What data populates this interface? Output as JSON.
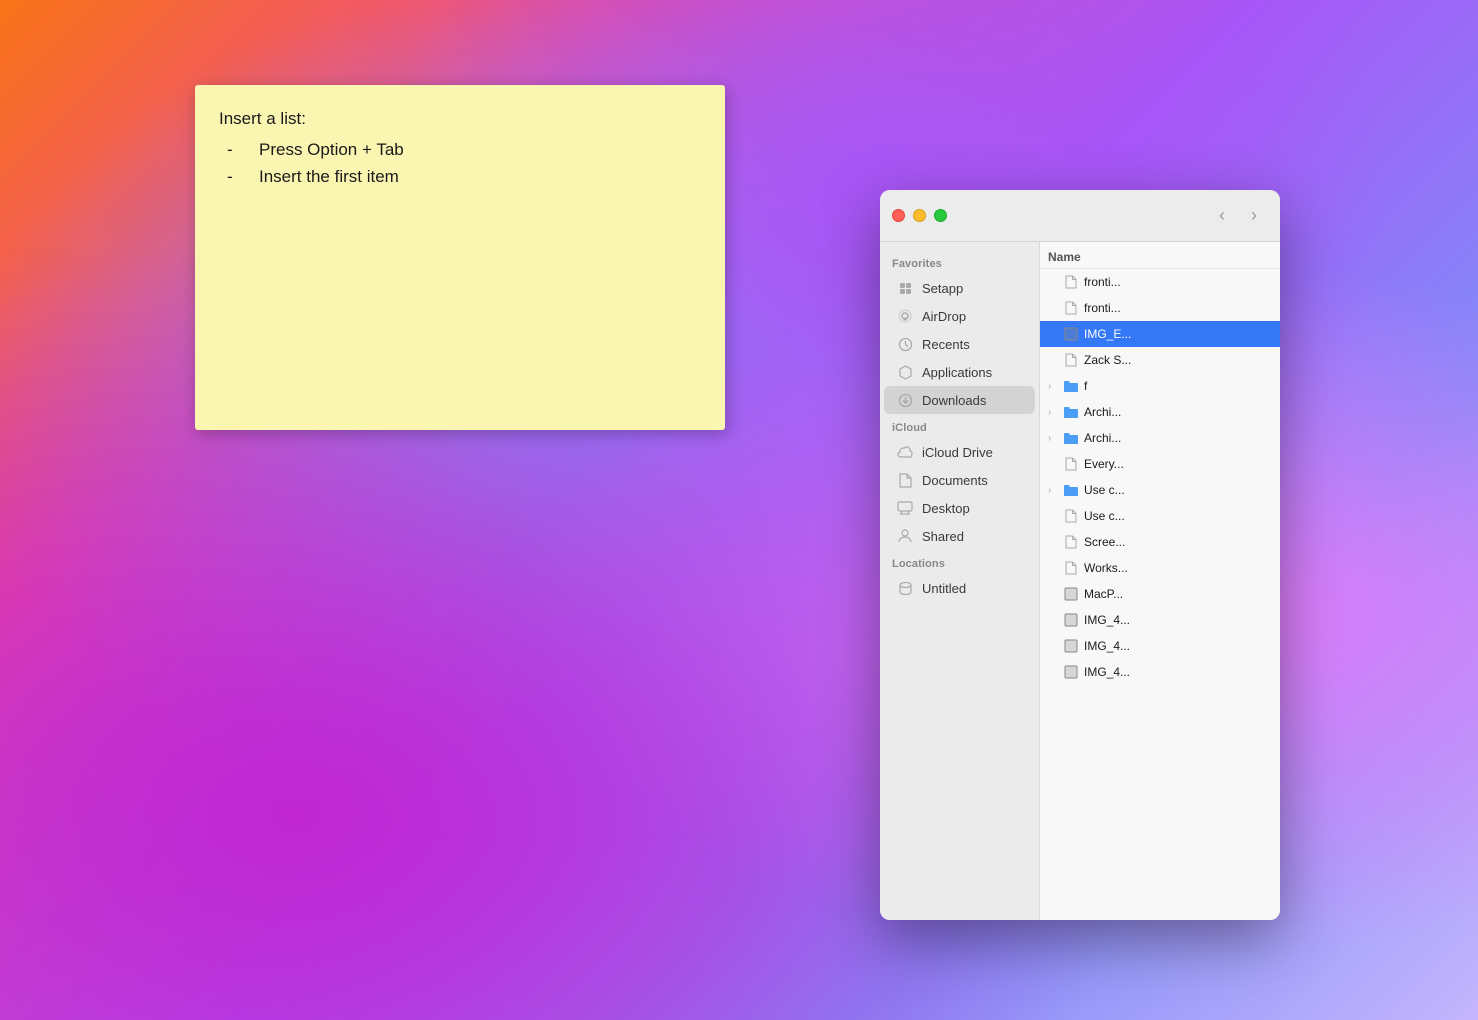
{
  "desktop": {
    "bg": "macOS Big Sur wallpaper"
  },
  "sticky_note": {
    "title": "Insert a list:",
    "items": [
      {
        "dash": "-",
        "text": "Press Option + Tab"
      },
      {
        "dash": "-",
        "text": "Insert the first item"
      }
    ]
  },
  "finder": {
    "titlebar": {
      "traffic_lights": [
        "close",
        "minimize",
        "maximize"
      ],
      "nav_back_label": "‹",
      "nav_forward_label": "›"
    },
    "sidebar": {
      "sections": [
        {
          "header": "Favorites",
          "items": [
            {
              "id": "setapp",
              "label": "Setapp",
              "icon": "setapp"
            },
            {
              "id": "airdrop",
              "label": "AirDrop",
              "icon": "airdrop"
            },
            {
              "id": "recents",
              "label": "Recents",
              "icon": "recents"
            },
            {
              "id": "applications",
              "label": "Applications",
              "icon": "applications"
            },
            {
              "id": "downloads",
              "label": "Downloads",
              "icon": "downloads",
              "active": true
            }
          ]
        },
        {
          "header": "iCloud",
          "items": [
            {
              "id": "icloud-drive",
              "label": "iCloud Drive",
              "icon": "icloud-drive"
            },
            {
              "id": "documents",
              "label": "Documents",
              "icon": "documents"
            },
            {
              "id": "desktop",
              "label": "Desktop",
              "icon": "desktop"
            },
            {
              "id": "shared",
              "label": "Shared",
              "icon": "shared"
            }
          ]
        },
        {
          "header": "Locations",
          "items": [
            {
              "id": "untitled",
              "label": "Untitled",
              "icon": "untitled"
            }
          ]
        }
      ]
    },
    "filelist": {
      "column_header": "Name",
      "files": [
        {
          "id": "fronti1",
          "name": "fronti...",
          "type": "file",
          "icon": "📄",
          "chevron": false,
          "selected": false
        },
        {
          "id": "fronti2",
          "name": "fronti...",
          "type": "file",
          "icon": "📄",
          "chevron": false,
          "selected": false
        },
        {
          "id": "img_e",
          "name": "IMG_E...",
          "type": "image",
          "icon": "🖼",
          "chevron": false,
          "selected": true
        },
        {
          "id": "zack",
          "name": "Zack S...",
          "type": "contact",
          "icon": "👤",
          "chevron": false,
          "selected": false
        },
        {
          "id": "f",
          "name": "f",
          "type": "folder",
          "icon": "📁",
          "chevron": true,
          "selected": false
        },
        {
          "id": "archi1",
          "name": "Archi...",
          "type": "folder",
          "icon": "📁",
          "chevron": true,
          "selected": false
        },
        {
          "id": "archi2",
          "name": "Archi...",
          "type": "folder",
          "icon": "📁",
          "chevron": true,
          "selected": false
        },
        {
          "id": "every",
          "name": "Every...",
          "type": "file",
          "icon": "📄",
          "chevron": false,
          "selected": false
        },
        {
          "id": "use-c1",
          "name": "Use c...",
          "type": "folder",
          "icon": "📁",
          "chevron": true,
          "selected": false
        },
        {
          "id": "use-c2",
          "name": "Use c...",
          "type": "file",
          "icon": "📄",
          "chevron": false,
          "selected": false
        },
        {
          "id": "scree",
          "name": "Scree...",
          "type": "file",
          "icon": "🖥",
          "chevron": false,
          "selected": false
        },
        {
          "id": "works",
          "name": "Works...",
          "type": "file",
          "icon": "📄",
          "chevron": false,
          "selected": false
        },
        {
          "id": "macp",
          "name": "MacP...",
          "type": "image",
          "icon": "🖼",
          "chevron": false,
          "selected": false
        },
        {
          "id": "img4-1",
          "name": "IMG_4...",
          "type": "image",
          "icon": "🖼",
          "chevron": false,
          "selected": false
        },
        {
          "id": "img4-2",
          "name": "IMG_4...",
          "type": "image",
          "icon": "🖼",
          "chevron": false,
          "selected": false
        },
        {
          "id": "img4-3",
          "name": "IMG_4...",
          "type": "image",
          "icon": "🖼",
          "chevron": false,
          "selected": false
        }
      ]
    }
  }
}
